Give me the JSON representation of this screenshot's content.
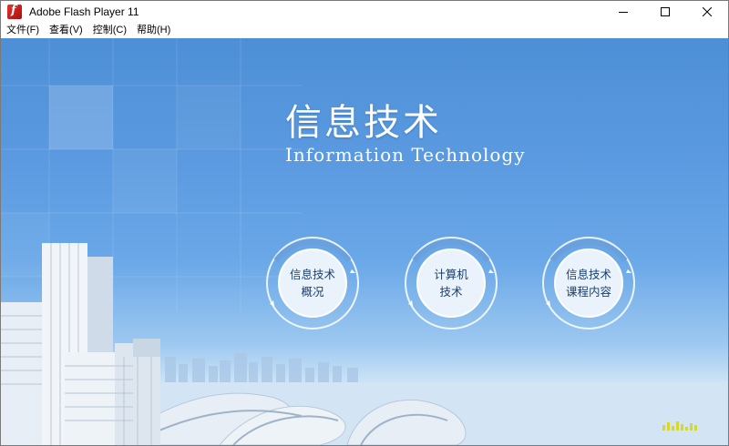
{
  "window": {
    "title": "Adobe Flash Player 11",
    "icon": "flash-player-icon",
    "controls": [
      "minimize-icon",
      "maximize-icon",
      "close-icon"
    ]
  },
  "menu": {
    "items": [
      {
        "label": "文件(F)"
      },
      {
        "label": "查看(V)"
      },
      {
        "label": "控制(C)"
      },
      {
        "label": "帮助(H)"
      }
    ]
  },
  "content": {
    "title_cn": "信息技术",
    "title_en": "Information  Technology",
    "buttons": [
      {
        "line1": "信息技术",
        "line2": "概况"
      },
      {
        "line1": "计算机",
        "line2": "技术"
      },
      {
        "line1": "信息技术",
        "line2": "课程内容"
      }
    ],
    "colors": {
      "sky_top": "#4d8fd6",
      "sky_bottom": "#dcebf7",
      "label": "#1a3f6e",
      "accent": "#d8d82a"
    }
  }
}
